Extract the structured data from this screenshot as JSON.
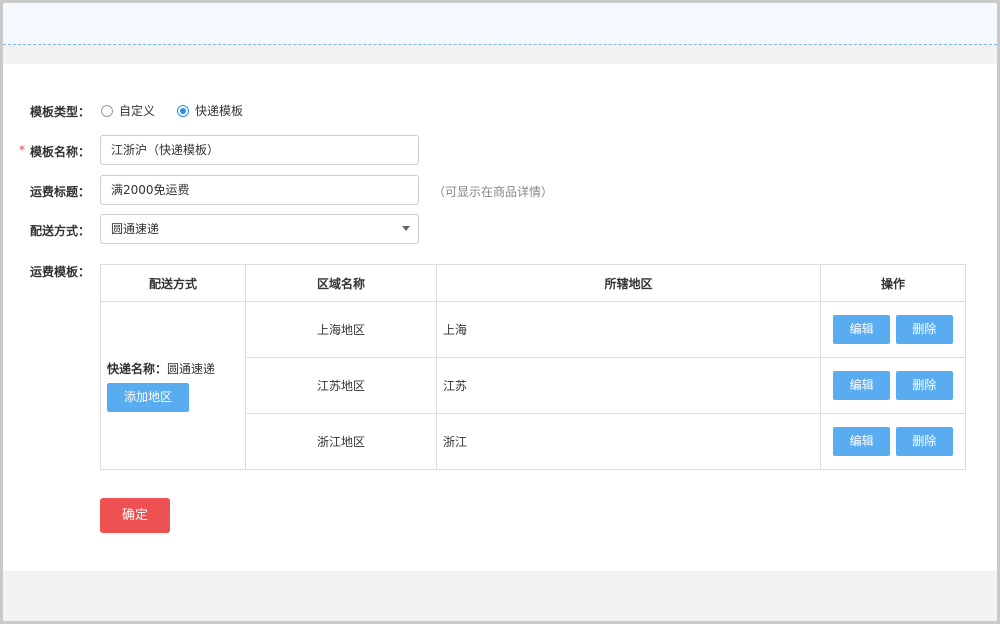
{
  "form": {
    "template_type": {
      "label": "模板类型：",
      "options": [
        {
          "label": "自定义",
          "checked": false
        },
        {
          "label": "快递模板",
          "checked": true
        }
      ]
    },
    "template_name": {
      "required_mark": "*",
      "label": "模板名称：",
      "value": "江浙沪（快递模板）"
    },
    "shipping_title": {
      "label": "运费标题：",
      "value": "满2000免运费",
      "hint": "（可显示在商品详情）"
    },
    "delivery_method": {
      "label": "配送方式：",
      "value": "圆通速递"
    },
    "shipping_template": {
      "label": "运费模板："
    }
  },
  "table": {
    "headers": [
      "配送方式",
      "区域名称",
      "所辖地区",
      "操作"
    ],
    "method": {
      "name_label": "快递名称：",
      "name_value": "圆通速递",
      "add_button": "添加地区"
    },
    "rows": [
      {
        "region": "上海地区",
        "area": "上海",
        "edit": "编辑",
        "delete": "删除"
      },
      {
        "region": "江苏地区",
        "area": "江苏",
        "edit": "编辑",
        "delete": "删除"
      },
      {
        "region": "浙江地区",
        "area": "浙江",
        "edit": "编辑",
        "delete": "删除"
      }
    ]
  },
  "confirm_button": "确定",
  "colors": {
    "accent_blue": "#5aacf0",
    "radio_blue": "#2d8fe6",
    "confirm_red": "#ee5152",
    "topbar_bg": "#f3f9fe"
  }
}
